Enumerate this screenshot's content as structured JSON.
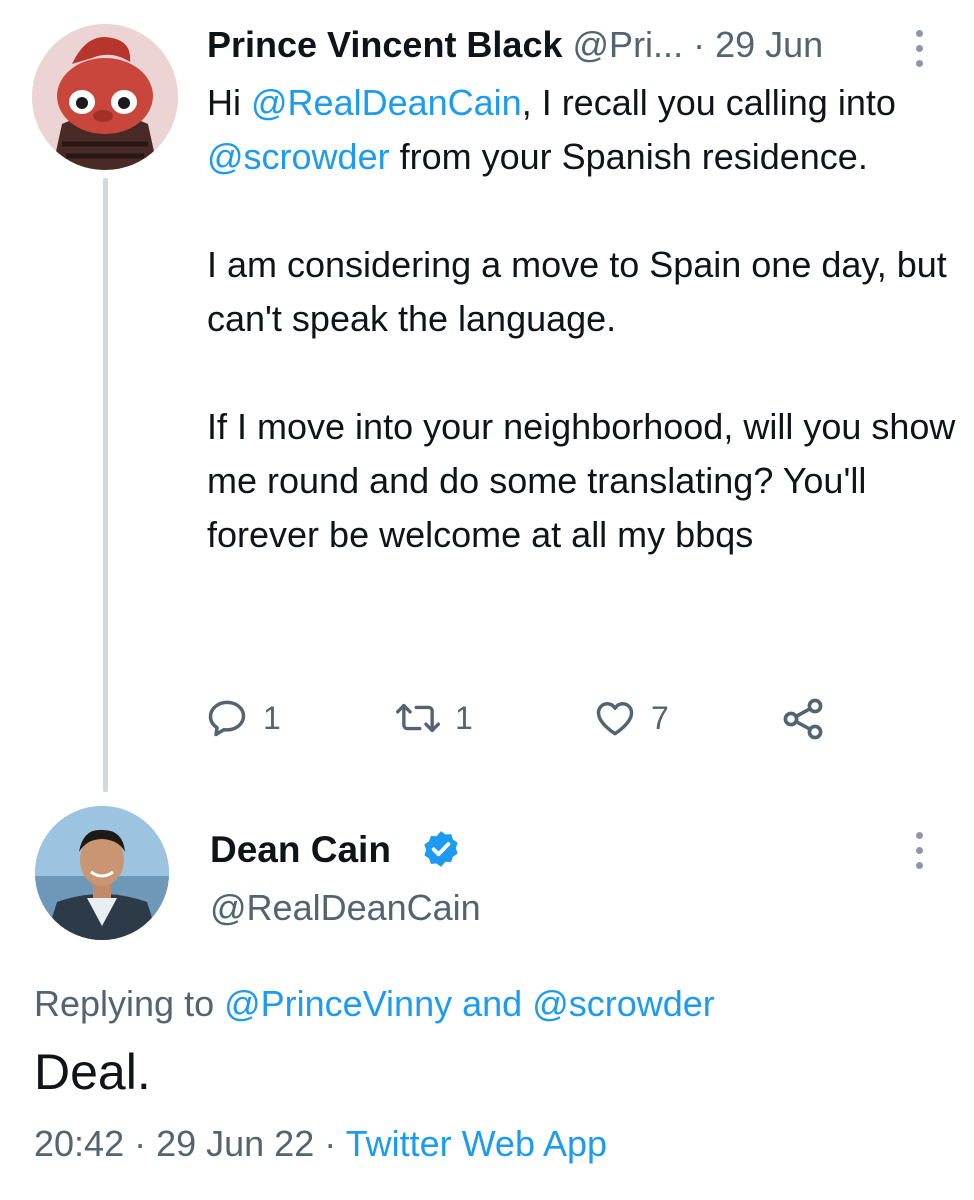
{
  "parent_tweet": {
    "display_name": "Prince Vincent Black",
    "handle": "@Pri...",
    "separator": "·",
    "date": "29 Jun",
    "body": {
      "p1_prefix": "Hi ",
      "p1_mention1": "@RealDeanCain",
      "p1_mid": ", I recall you calling into ",
      "p1_mention2": "@scrowder",
      "p1_suffix": " from your Spanish residence.",
      "p2": "I am considering a move to Spain one day, but can't speak the language.",
      "p3": "If I move into your neighborhood, will you show me round and do some translating? You'll forever be welcome at all my bbqs"
    },
    "actions": {
      "reply_icon": "reply-icon",
      "reply_count": "1",
      "retweet_icon": "retweet-icon",
      "retweet_count": "1",
      "like_icon": "heart-icon",
      "like_count": "7",
      "share_icon": "share-icon"
    }
  },
  "main_tweet": {
    "display_name": "Dean Cain",
    "verified_icon": "verified-badge-icon",
    "handle": "@RealDeanCain",
    "replying_prefix": "Replying to ",
    "replying_user1": "@PrinceVinny",
    "replying_and": " and ",
    "replying_user2": "@scrowder",
    "body": "Deal.",
    "time": "20:42",
    "separator": " · ",
    "date": "29 Jun 22",
    "source": "Twitter Web App"
  },
  "colors": {
    "link": "#1d9bf0",
    "secondary_text": "#536471",
    "primary_text": "#0f1419",
    "thread_line": "#cfd9de",
    "verified": "#1d9bf0"
  }
}
